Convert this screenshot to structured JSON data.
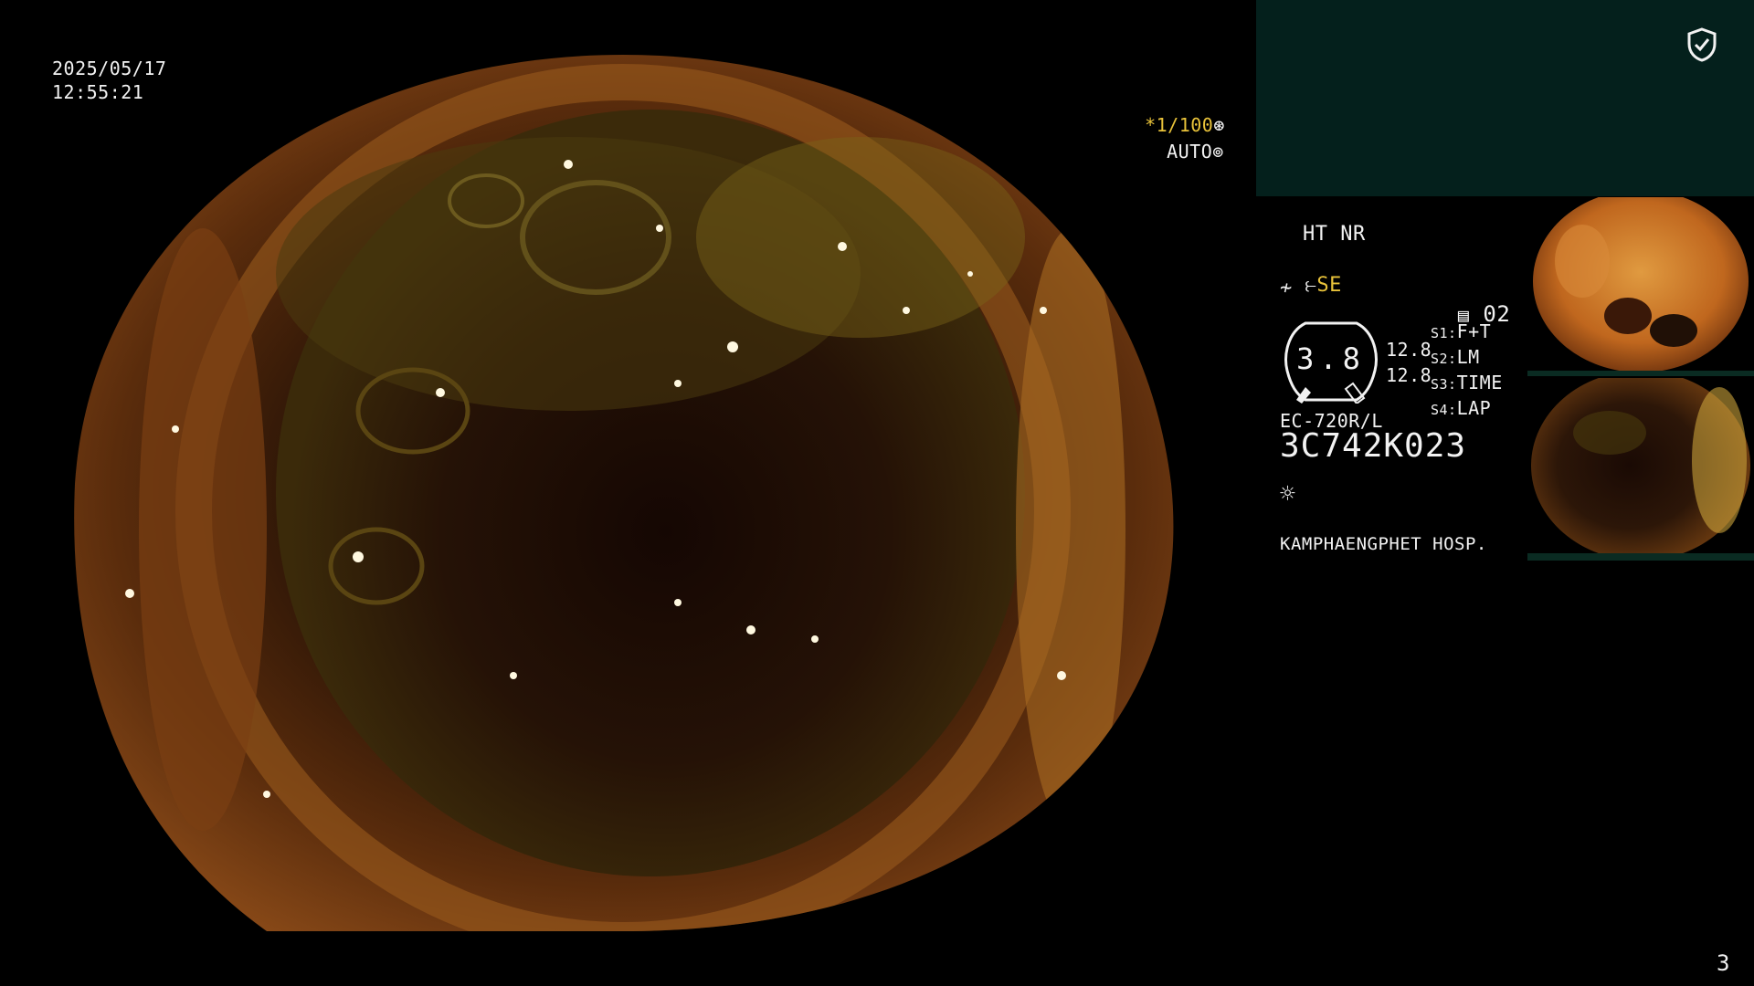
{
  "datetime": {
    "date": "2025/05/17",
    "time": "12:55:21"
  },
  "exposure": {
    "shutter": "*1/100",
    "shutter_icon": "aperture-icon",
    "mode": "AUTO",
    "mode_icon": "iris-icon"
  },
  "panel": {
    "shield_icon": "shield-check-icon",
    "modes": "HT NR",
    "se_icon": "enhance-icon",
    "se_label": "SE",
    "filter_icon": "filter-icon",
    "memo_icon": "memo-icon",
    "memo_count": "02",
    "gauge_value": "3.8",
    "gauge_left": "12.8",
    "gauge_right": "12.8",
    "switches": [
      {
        "key": "S1:",
        "value": "F+T"
      },
      {
        "key": "S2:",
        "value": "LM"
      },
      {
        "key": "S3:",
        "value": "TIME"
      },
      {
        "key": "S4:",
        "value": "LAP"
      }
    ],
    "model": "EC-720R/L",
    "serial": "3C742K023",
    "light_icon": "brightness-icon",
    "hospital": "KAMPHAENGPHET HOSP."
  },
  "colors": {
    "top_panel": "#04201c",
    "highlight_yellow": "#e8c23a",
    "text": "#f2f2f2"
  },
  "page_number": "3"
}
